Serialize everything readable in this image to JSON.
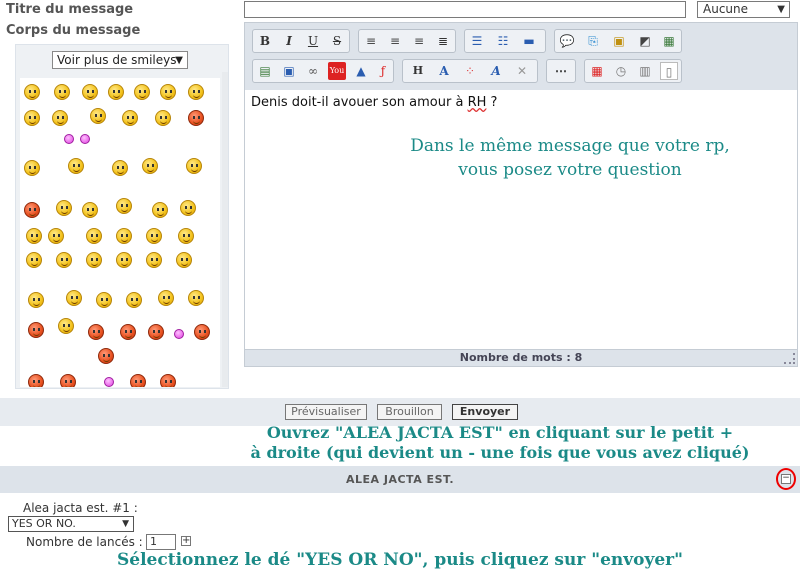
{
  "form": {
    "title_label": "Titre du message",
    "body_label": "Corps du message",
    "title_value": "",
    "font_select": "Aucune"
  },
  "smileys": {
    "more_select": "Voir plus de smileys"
  },
  "editor": {
    "text_prefix": "Denis doit-il avouer son amour à ",
    "text_underlined": "RH",
    "text_suffix": " ?",
    "word_count_label": "Nombre de mots : 8"
  },
  "toolbar": {
    "bold": "B",
    "italic": "I",
    "underline": "U",
    "strike": "S",
    "heading": "H",
    "size": "A",
    "font": "A"
  },
  "annotations": {
    "editor_line1": "Dans le même message que votre rp,",
    "editor_line2": "vous posez votre question",
    "alea_line1": "Ouvrez \"ALEA JACTA EST\" en cliquant sur le petit +",
    "alea_line2": "à droite (qui devient un - une fois que vous avez cliqué)",
    "bottom": "Sélectionnez le dé \"YES OR NO\", puis cliquez sur \"envoyer\""
  },
  "actions": {
    "preview": "Prévisualiser",
    "draft": "Brouillon",
    "send": "Envoyer"
  },
  "alea": {
    "section_title": "ALEA JACTA EST.",
    "collapse_symbol": "−",
    "dice_label": "Alea jacta est. #1 :",
    "dice_value": "YES OR NO.",
    "rolls_label": "Nombre de lancés :",
    "rolls_value": "1",
    "plus_symbol": "+"
  },
  "colors": {
    "annotation": "#1b8a87",
    "toolbar_bg": "#dde3ea",
    "highlight": "#e00000"
  }
}
